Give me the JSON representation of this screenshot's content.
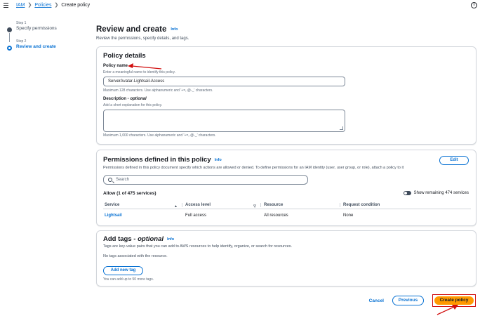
{
  "breadcrumb": {
    "items": [
      "IAM",
      "Policies",
      "Create policy"
    ]
  },
  "steps": [
    {
      "number": "Step 1",
      "title": "Specify permissions"
    },
    {
      "number": "Step 2",
      "title": "Review and create"
    }
  ],
  "header": {
    "title": "Review and create",
    "info": "Info",
    "description": "Review the permissions, specify details, and tags."
  },
  "policy_details": {
    "title": "Policy details",
    "name_label": "Policy name",
    "name_hint": "Enter a meaningful name to identify this policy.",
    "name_value": "ServerAvatar-Lightsail-Access",
    "name_constraint": "Maximum 128 characters. Use alphanumeric and '+=,.@-_' characters.",
    "description_label": "Description - ",
    "description_optional": "optional",
    "description_hint": "Add a short explanation for this policy.",
    "description_value": "",
    "description_constraint": "Maximum 1,000 characters. Use alphanumeric and '+=,.@-_' characters."
  },
  "permissions": {
    "title": "Permissions defined in this policy",
    "info": "Info",
    "edit_label": "Edit",
    "description": "Permissions defined in this policy document specify which actions are allowed or denied. To define permissions for an IAM identity (user, user group, or role), attach a policy to it",
    "search_placeholder": "Search",
    "allow_label": "Allow (1 of 475 services)",
    "toggle_label": "Show remaining 474 services",
    "columns": [
      "Service",
      "Access level",
      "Resource",
      "Request condition"
    ],
    "rows": [
      {
        "service": "Lightsail",
        "access_level": "Full access",
        "resource": "All resources",
        "request_condition": "None"
      }
    ]
  },
  "tags": {
    "title": "Add tags - ",
    "title_optional": "optional",
    "info": "Info",
    "description": "Tags are key-value pairs that you can add to AWS resources to help identify, organize, or search for resources.",
    "empty_text": "No tags associated with the resource.",
    "add_button": "Add new tag",
    "limit_text": "You can add up to 50 more tags."
  },
  "footer": {
    "cancel": "Cancel",
    "previous": "Previous",
    "create": "Create policy"
  },
  "colors": {
    "accent": "#0972d3",
    "primary_button": "#ff9900",
    "highlight": "#d10d0d"
  }
}
